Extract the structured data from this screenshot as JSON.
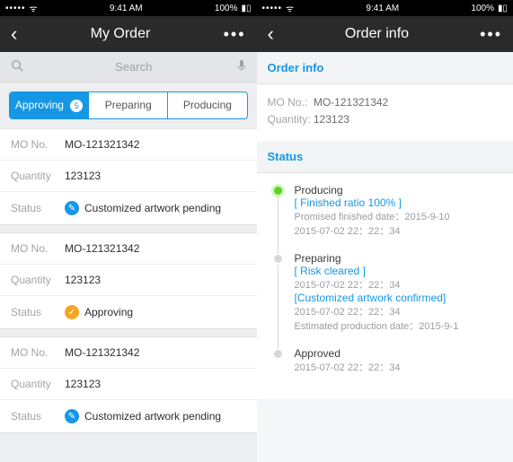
{
  "statusbar": {
    "time": "9:41 AM",
    "battery": "100%"
  },
  "left": {
    "title": "My Order",
    "search": "Search",
    "tabs": [
      {
        "label": "Approving",
        "count": "5",
        "active": true
      },
      {
        "label": "Preparing"
      },
      {
        "label": "Producing"
      }
    ],
    "labels": {
      "mo": "MO No.",
      "qty": "Quantity",
      "status": "Status"
    },
    "orders": [
      {
        "mo": "MO-121321342",
        "qty": "123123",
        "status": "Customized artwork pending",
        "color": "blue"
      },
      {
        "mo": "MO-121321342",
        "qty": "123123",
        "status": "Approving",
        "color": "orange"
      },
      {
        "mo": "MO-121321342",
        "qty": "123123",
        "status": "Customized artwork pending",
        "color": "blue"
      }
    ]
  },
  "right": {
    "title": "Order info",
    "section_info": "Order info",
    "mo_label": "MO No.:",
    "mo": "MO-121321342",
    "qty_label": "Quantity:",
    "qty": "123123",
    "section_status": "Status",
    "timeline": [
      {
        "dot": "green",
        "title": "Producing",
        "hl1": "[ Finished ratio 100% ]",
        "sub1": "Promised finished date：2015-9-10",
        "sub2": "2015-07-02  22：22：34"
      },
      {
        "dot": "gray",
        "title": "Preparing",
        "hl1": "[ Risk cleared ]",
        "sub1": "2015-07-02  22：22：34",
        "hl2": "[Customized artwork confirmed]",
        "sub2": "2015-07-02 22：22：34",
        "sub3": "Estimated production date：2015-9-1"
      },
      {
        "dot": "gray",
        "title": "Approved",
        "sub1": "2015-07-02  22：22：34"
      }
    ]
  }
}
